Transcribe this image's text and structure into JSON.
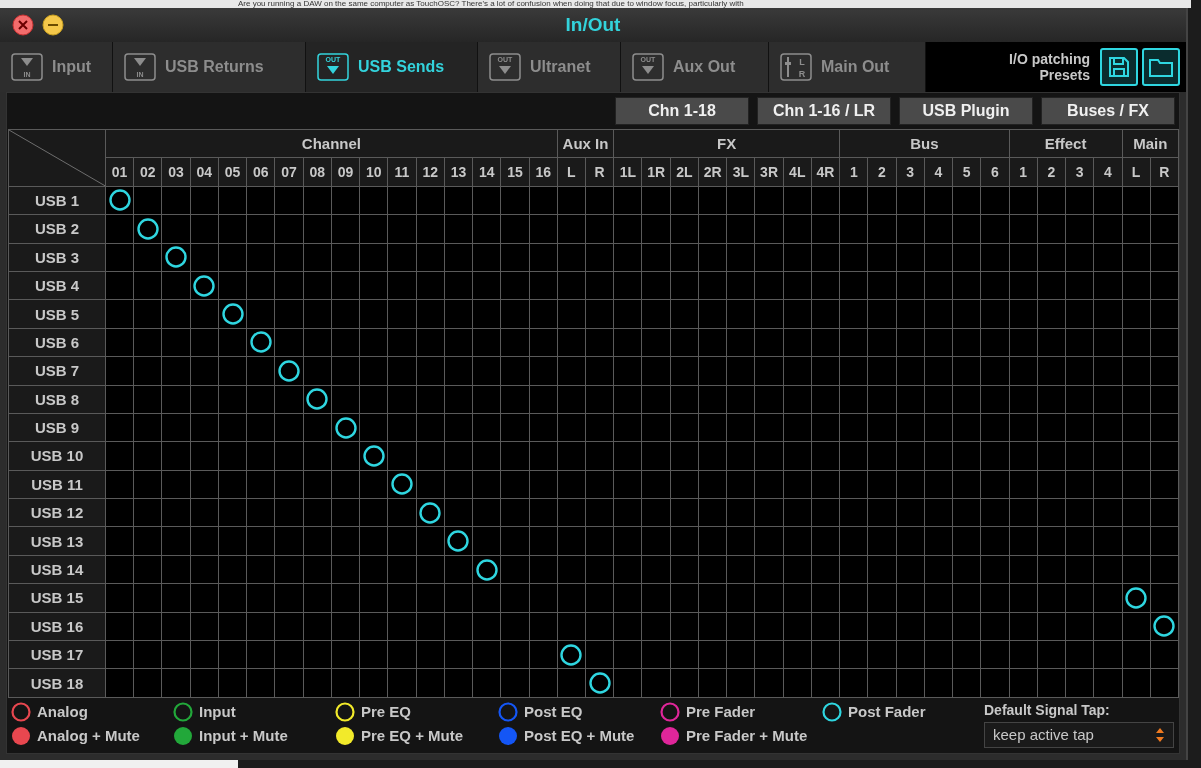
{
  "background_text": "Are you running a DAW on the same computer as TouchOSC? There's a lot of confusion when doing that due to window focus, particularly with",
  "window": {
    "title": "In/Out"
  },
  "tabs": [
    {
      "label": "Input",
      "kind": "in",
      "icon_text": "IN",
      "selected": false
    },
    {
      "label": "USB Returns",
      "kind": "in",
      "icon_text": "IN",
      "selected": false
    },
    {
      "label": "USB Sends",
      "kind": "out",
      "icon_text": "OUT",
      "selected": true
    },
    {
      "label": "Ultranet",
      "kind": "out",
      "icon_text": "OUT",
      "selected": false
    },
    {
      "label": "Aux Out",
      "kind": "out",
      "icon_text": "OUT",
      "selected": false
    },
    {
      "label": "Main Out",
      "kind": "lr",
      "icon_text": "L R",
      "selected": false
    }
  ],
  "presets": {
    "label": "I/O patching Presets"
  },
  "view_buttons": [
    "Chn 1-18",
    "Chn 1-16 / LR",
    "USB Plugin",
    "Buses / FX"
  ],
  "groups": [
    {
      "name": "Channel",
      "columns": [
        "01",
        "02",
        "03",
        "04",
        "05",
        "06",
        "07",
        "08",
        "09",
        "10",
        "11",
        "12",
        "13",
        "14",
        "15",
        "16"
      ]
    },
    {
      "name": "Aux In",
      "columns": [
        "L",
        "R"
      ]
    },
    {
      "name": "FX",
      "columns": [
        "1L",
        "1R",
        "2L",
        "2R",
        "3L",
        "3R",
        "4L",
        "4R"
      ]
    },
    {
      "name": "Bus",
      "columns": [
        "1",
        "2",
        "3",
        "4",
        "5",
        "6"
      ]
    },
    {
      "name": "Effect",
      "columns": [
        "1",
        "2",
        "3",
        "4"
      ]
    },
    {
      "name": "Main",
      "columns": [
        "L",
        "R"
      ]
    }
  ],
  "rows": [
    {
      "label": "USB 1",
      "color": "#2fd6e0",
      "cells": [
        true,
        false,
        false,
        false,
        false,
        false,
        false,
        false,
        false,
        false,
        false,
        false,
        false,
        false,
        false,
        false,
        false,
        false,
        false,
        false,
        false,
        false,
        false,
        false,
        false,
        false,
        false,
        false,
        false,
        false,
        false,
        false,
        false,
        false,
        false,
        false,
        false,
        false
      ]
    },
    {
      "label": "USB 2",
      "color": "#2fd6e0",
      "cells": [
        false,
        true,
        false,
        false,
        false,
        false,
        false,
        false,
        false,
        false,
        false,
        false,
        false,
        false,
        false,
        false,
        false,
        false,
        false,
        false,
        false,
        false,
        false,
        false,
        false,
        false,
        false,
        false,
        false,
        false,
        false,
        false,
        false,
        false,
        false,
        false,
        false,
        false
      ]
    },
    {
      "label": "USB 3",
      "color": "#2fd6e0",
      "cells": [
        false,
        false,
        true,
        false,
        false,
        false,
        false,
        false,
        false,
        false,
        false,
        false,
        false,
        false,
        false,
        false,
        false,
        false,
        false,
        false,
        false,
        false,
        false,
        false,
        false,
        false,
        false,
        false,
        false,
        false,
        false,
        false,
        false,
        false,
        false,
        false,
        false,
        false
      ]
    },
    {
      "label": "USB 4",
      "color": "#2fd6e0",
      "cells": [
        false,
        false,
        false,
        true,
        false,
        false,
        false,
        false,
        false,
        false,
        false,
        false,
        false,
        false,
        false,
        false,
        false,
        false,
        false,
        false,
        false,
        false,
        false,
        false,
        false,
        false,
        false,
        false,
        false,
        false,
        false,
        false,
        false,
        false,
        false,
        false,
        false,
        false
      ]
    },
    {
      "label": "USB 5",
      "color": "#2fd6e0",
      "cells": [
        false,
        false,
        false,
        false,
        true,
        false,
        false,
        false,
        false,
        false,
        false,
        false,
        false,
        false,
        false,
        false,
        false,
        false,
        false,
        false,
        false,
        false,
        false,
        false,
        false,
        false,
        false,
        false,
        false,
        false,
        false,
        false,
        false,
        false,
        false,
        false,
        false,
        false
      ]
    },
    {
      "label": "USB 6",
      "color": "#2fd6e0",
      "cells": [
        false,
        false,
        false,
        false,
        false,
        true,
        false,
        false,
        false,
        false,
        false,
        false,
        false,
        false,
        false,
        false,
        false,
        false,
        false,
        false,
        false,
        false,
        false,
        false,
        false,
        false,
        false,
        false,
        false,
        false,
        false,
        false,
        false,
        false,
        false,
        false,
        false,
        false
      ]
    },
    {
      "label": "USB 7",
      "color": "#2fd6e0",
      "cells": [
        false,
        false,
        false,
        false,
        false,
        false,
        true,
        false,
        false,
        false,
        false,
        false,
        false,
        false,
        false,
        false,
        false,
        false,
        false,
        false,
        false,
        false,
        false,
        false,
        false,
        false,
        false,
        false,
        false,
        false,
        false,
        false,
        false,
        false,
        false,
        false,
        false,
        false
      ]
    },
    {
      "label": "USB 8",
      "color": "#2fd6e0",
      "cells": [
        false,
        false,
        false,
        false,
        false,
        false,
        false,
        true,
        false,
        false,
        false,
        false,
        false,
        false,
        false,
        false,
        false,
        false,
        false,
        false,
        false,
        false,
        false,
        false,
        false,
        false,
        false,
        false,
        false,
        false,
        false,
        false,
        false,
        false,
        false,
        false,
        false,
        false
      ]
    },
    {
      "label": "USB 9",
      "color": "#2fd6e0",
      "cells": [
        false,
        false,
        false,
        false,
        false,
        false,
        false,
        false,
        true,
        false,
        false,
        false,
        false,
        false,
        false,
        false,
        false,
        false,
        false,
        false,
        false,
        false,
        false,
        false,
        false,
        false,
        false,
        false,
        false,
        false,
        false,
        false,
        false,
        false,
        false,
        false,
        false,
        false
      ]
    },
    {
      "label": "USB 10",
      "color": "#2fd6e0",
      "cells": [
        false,
        false,
        false,
        false,
        false,
        false,
        false,
        false,
        false,
        true,
        false,
        false,
        false,
        false,
        false,
        false,
        false,
        false,
        false,
        false,
        false,
        false,
        false,
        false,
        false,
        false,
        false,
        false,
        false,
        false,
        false,
        false,
        false,
        false,
        false,
        false,
        false,
        false
      ]
    },
    {
      "label": "USB 11",
      "color": "#2fd6e0",
      "cells": [
        false,
        false,
        false,
        false,
        false,
        false,
        false,
        false,
        false,
        false,
        true,
        false,
        false,
        false,
        false,
        false,
        false,
        false,
        false,
        false,
        false,
        false,
        false,
        false,
        false,
        false,
        false,
        false,
        false,
        false,
        false,
        false,
        false,
        false,
        false,
        false,
        false,
        false
      ]
    },
    {
      "label": "USB 12",
      "color": "#2fd6e0",
      "cells": [
        false,
        false,
        false,
        false,
        false,
        false,
        false,
        false,
        false,
        false,
        false,
        true,
        false,
        false,
        false,
        false,
        false,
        false,
        false,
        false,
        false,
        false,
        false,
        false,
        false,
        false,
        false,
        false,
        false,
        false,
        false,
        false,
        false,
        false,
        false,
        false,
        false,
        false
      ]
    },
    {
      "label": "USB 13",
      "color": "#2fd6e0",
      "cells": [
        false,
        false,
        false,
        false,
        false,
        false,
        false,
        false,
        false,
        false,
        false,
        false,
        true,
        false,
        false,
        false,
        false,
        false,
        false,
        false,
        false,
        false,
        false,
        false,
        false,
        false,
        false,
        false,
        false,
        false,
        false,
        false,
        false,
        false,
        false,
        false,
        false,
        false
      ]
    },
    {
      "label": "USB 14",
      "color": "#2fd6e0",
      "cells": [
        false,
        false,
        false,
        false,
        false,
        false,
        false,
        false,
        false,
        false,
        false,
        false,
        false,
        true,
        false,
        false,
        false,
        false,
        false,
        false,
        false,
        false,
        false,
        false,
        false,
        false,
        false,
        false,
        false,
        false,
        false,
        false,
        false,
        false,
        false,
        false,
        false,
        false
      ]
    },
    {
      "label": "USB 15",
      "color": "#2fd6e0",
      "cells": [
        false,
        false,
        false,
        false,
        false,
        false,
        false,
        false,
        false,
        false,
        false,
        false,
        false,
        false,
        false,
        false,
        false,
        false,
        false,
        false,
        false,
        false,
        false,
        false,
        false,
        false,
        false,
        false,
        false,
        false,
        false,
        false,
        false,
        false,
        false,
        false,
        true,
        false
      ]
    },
    {
      "label": "USB 16",
      "color": "#2fd6e0",
      "cells": [
        false,
        false,
        false,
        false,
        false,
        false,
        false,
        false,
        false,
        false,
        false,
        false,
        false,
        false,
        false,
        false,
        false,
        false,
        false,
        false,
        false,
        false,
        false,
        false,
        false,
        false,
        false,
        false,
        false,
        false,
        false,
        false,
        false,
        false,
        false,
        false,
        false,
        true
      ]
    },
    {
      "label": "USB 17",
      "color": "#2fd6e0",
      "cells": [
        false,
        false,
        false,
        false,
        false,
        false,
        false,
        false,
        false,
        false,
        false,
        false,
        false,
        false,
        false,
        false,
        true,
        false,
        false,
        false,
        false,
        false,
        false,
        false,
        false,
        false,
        false,
        false,
        false,
        false,
        false,
        false,
        false,
        false,
        false,
        false,
        false,
        false
      ]
    },
    {
      "label": "USB 18",
      "color": "#2fd6e0",
      "cells": [
        false,
        false,
        false,
        false,
        false,
        false,
        false,
        false,
        false,
        false,
        false,
        false,
        false,
        false,
        false,
        false,
        false,
        true,
        false,
        false,
        false,
        false,
        false,
        false,
        false,
        false,
        false,
        false,
        false,
        false,
        false,
        false,
        false,
        false,
        false,
        false,
        false,
        false
      ]
    }
  ],
  "legend": [
    {
      "label": "Analog",
      "mute_label": "Analog + Mute",
      "color": "#e8474f"
    },
    {
      "label": "Input",
      "mute_label": "Input + Mute",
      "color": "#22a83a"
    },
    {
      "label": "Pre EQ",
      "mute_label": "Pre EQ + Mute",
      "color": "#f2ea2a"
    },
    {
      "label": "Post EQ",
      "mute_label": "Post EQ + Mute",
      "color": "#1456f5"
    },
    {
      "label": "Pre Fader",
      "mute_label": "Pre Fader + Mute",
      "color": "#e0269a"
    },
    {
      "label": "Post Fader",
      "color": "#2fd6e0"
    }
  ],
  "signal_tap": {
    "label": "Default Signal Tap:",
    "value": "keep active tap"
  }
}
